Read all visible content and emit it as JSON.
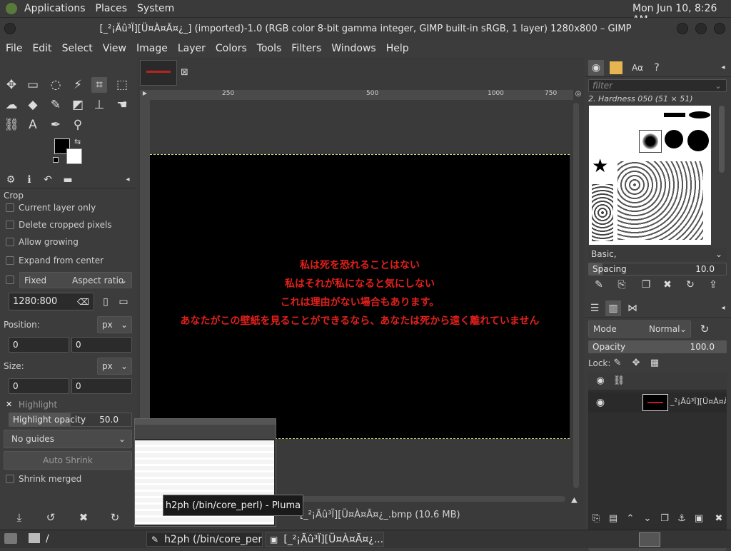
{
  "topbar": {
    "applications": "Applications",
    "places": "Places",
    "system": "System",
    "clock": "Mon Jun 10,  8:26 AM"
  },
  "window": {
    "title": "[_²¡Ãû³Ï][Ü¤À¤Ã¤¿_] (imported)-1.0 (RGB color 8-bit gamma integer, GIMP built-in sRGB, 1 layer) 1280x800 – GIMP"
  },
  "menu": [
    "File",
    "Edit",
    "Select",
    "View",
    "Image",
    "Layer",
    "Colors",
    "Tools",
    "Filters",
    "Windows",
    "Help"
  ],
  "tool_options": {
    "title": "Crop",
    "current_layer_only": "Current layer only",
    "delete_cropped": "Delete cropped pixels",
    "allow_growing": "Allow growing",
    "expand_center": "Expand from center",
    "fixed": "Fixed",
    "aspect": "Aspect ratio",
    "ratio_value": "1280:800",
    "position_label": "Position:",
    "size_label": "Size:",
    "unit": "px",
    "pos_x": "0",
    "pos_y": "0",
    "size_w": "0",
    "size_h": "0",
    "highlight": "Highlight",
    "highlight_opacity_label": "Highlight opacity",
    "highlight_opacity_value": "50.0",
    "guides": "No guides",
    "auto_shrink": "Auto Shrink",
    "shrink_merged": "Shrink merged"
  },
  "ruler": {
    "t250": "250",
    "t500": "500",
    "t750": "750",
    "t1000": "1000"
  },
  "image_text": [
    "私は死を恐れることはない",
    "私はそれが私になると気にしない",
    "これは理由がない場合もあります。",
    "あなたがこの壁紙を見ることができるなら、あなたは死から遠く離れていません"
  ],
  "statusbar": {
    "file": "[_²¡Ãû³Ï][Ü¤À¤Ã¤¿_.bmp (10.6 MB)"
  },
  "brushes": {
    "filter_placeholder": "filter",
    "brush_name": "2. Hardness 050 (51 × 51)",
    "preset": "Basic,",
    "spacing_label": "Spacing",
    "spacing_value": "10.0"
  },
  "layers": {
    "mode_label": "Mode",
    "mode_value": "Normal",
    "opacity_label": "Opacity",
    "opacity_value": "100.0",
    "lock_label": "Lock:",
    "layer_name": "_²¡Ãû³Ï][Ü¤À¤Ã"
  },
  "tooltip": "h2ph (/bin/core_perl) - Pluma",
  "taskbar": {
    "folder": "/",
    "task1": "h2ph (/bin/core_per...",
    "task2": "[_²¡Ãû³Ï][Ü¤À¤Ã¤¿..."
  }
}
